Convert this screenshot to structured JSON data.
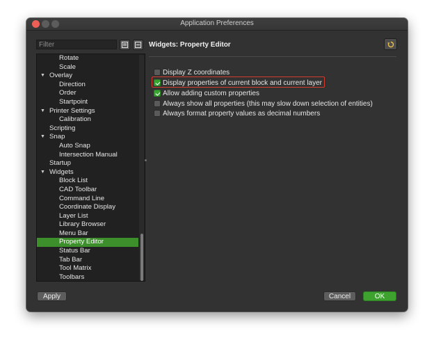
{
  "window": {
    "title": "Application Preferences"
  },
  "filter": {
    "placeholder": "Filter"
  },
  "tree": {
    "items": [
      {
        "label": "Rotate",
        "level": 1
      },
      {
        "label": "Scale",
        "level": 1
      },
      {
        "label": "Overlay",
        "level": 0,
        "expanded": true
      },
      {
        "label": "Direction",
        "level": 1
      },
      {
        "label": "Order",
        "level": 1
      },
      {
        "label": "Startpoint",
        "level": 1
      },
      {
        "label": "Printer Settings",
        "level": 0,
        "expanded": true
      },
      {
        "label": "Calibration",
        "level": 1
      },
      {
        "label": "Scripting",
        "level": 0
      },
      {
        "label": "Snap",
        "level": 0,
        "expanded": true
      },
      {
        "label": "Auto Snap",
        "level": 1
      },
      {
        "label": "Intersection Manual",
        "level": 1
      },
      {
        "label": "Startup",
        "level": 0
      },
      {
        "label": "Widgets",
        "level": 0,
        "expanded": true
      },
      {
        "label": "Block List",
        "level": 1
      },
      {
        "label": "CAD Toolbar",
        "level": 1
      },
      {
        "label": "Command Line",
        "level": 1
      },
      {
        "label": "Coordinate Display",
        "level": 1
      },
      {
        "label": "Layer List",
        "level": 1
      },
      {
        "label": "Library Browser",
        "level": 1
      },
      {
        "label": "Menu Bar",
        "level": 1
      },
      {
        "label": "Property Editor",
        "level": 1,
        "selected": true
      },
      {
        "label": "Status Bar",
        "level": 1
      },
      {
        "label": "Tab Bar",
        "level": 1
      },
      {
        "label": "Tool Matrix",
        "level": 1
      },
      {
        "label": "Toolbars",
        "level": 1
      }
    ]
  },
  "panel": {
    "title": "Widgets: Property Editor",
    "options": [
      {
        "label": "Display Z coordinates",
        "checked": false
      },
      {
        "label": "Display properties of current block and current layer",
        "checked": true,
        "highlighted": true
      },
      {
        "label": "Allow adding custom properties",
        "checked": true
      },
      {
        "label": "Always show all properties (this may slow down selection of entities)",
        "checked": false
      },
      {
        "label": "Always format property values as decimal numbers",
        "checked": false
      }
    ]
  },
  "buttons": {
    "apply": "Apply",
    "cancel": "Cancel",
    "ok": "OK"
  },
  "colors": {
    "accent": "#3c8f2b",
    "highlight": "#d43c2c",
    "background": "#323232"
  },
  "icons": {
    "expand_all": "expand-all-icon",
    "collapse_all": "collapse-all-icon",
    "reset": "reset-icon"
  }
}
